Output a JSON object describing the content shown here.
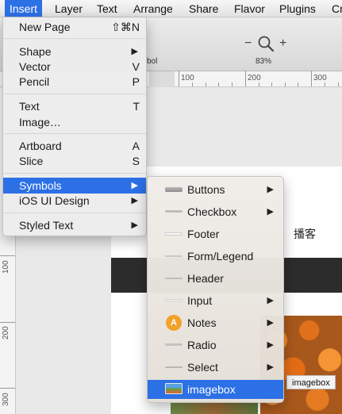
{
  "menubar": {
    "items": [
      "Insert",
      "Layer",
      "Text",
      "Arrange",
      "Share",
      "Flavor",
      "Plugins",
      "Cr"
    ]
  },
  "toolbar": {
    "zoom_minus": "−",
    "zoom_plus": "+",
    "zoom_level": "83%",
    "partial_label": "bol",
    "zoom_icon": "magnifier-icon"
  },
  "ruler": {
    "h_labels": [
      "100",
      "200",
      "300"
    ],
    "v_labels": [
      "100",
      "200",
      "300"
    ]
  },
  "insert_menu": {
    "items": [
      {
        "label": "New Page",
        "shortcut": "⇧⌘N"
      },
      {
        "label": "Shape",
        "submenu": true
      },
      {
        "label": "Vector",
        "shortcut": "V"
      },
      {
        "label": "Pencil",
        "shortcut": "P"
      },
      {
        "label": "Text",
        "shortcut": "T"
      },
      {
        "label": "Image…"
      },
      {
        "label": "Artboard",
        "shortcut": "A"
      },
      {
        "label": "Slice",
        "shortcut": "S"
      },
      {
        "label": "Symbols",
        "submenu": true,
        "highlighted": true
      },
      {
        "label": "iOS UI Design",
        "submenu": true
      },
      {
        "label": "Styled Text",
        "submenu": true
      }
    ]
  },
  "symbols_submenu": {
    "items": [
      {
        "label": "Buttons",
        "submenu": true,
        "icon": "button-thumbnail-icon"
      },
      {
        "label": "Checkbox",
        "submenu": true,
        "icon": "checkbox-thumbnail-icon"
      },
      {
        "label": "Footer",
        "icon": "footer-thumbnail-icon"
      },
      {
        "label": "Form/Legend",
        "icon": "form-thumbnail-icon"
      },
      {
        "label": "Header",
        "icon": "header-thumbnail-icon"
      },
      {
        "label": "Input",
        "submenu": true,
        "icon": "input-thumbnail-icon"
      },
      {
        "label": "Notes",
        "submenu": true,
        "icon": "notes-badge-icon",
        "badge": "A"
      },
      {
        "label": "Radio",
        "submenu": true,
        "icon": "radio-thumbnail-icon"
      },
      {
        "label": "Select",
        "submenu": true,
        "icon": "select-thumbnail-icon"
      },
      {
        "label": "imagebox",
        "highlighted": true,
        "icon": "imagebox-thumbnail-icon"
      }
    ]
  },
  "canvas": {
    "cjk_text": "播客",
    "tooltip": "imagebox"
  },
  "colors": {
    "highlight": "#2c70e6",
    "menu_bg": "#ececec",
    "artboard_dark_bar": "#2c2c2c"
  }
}
